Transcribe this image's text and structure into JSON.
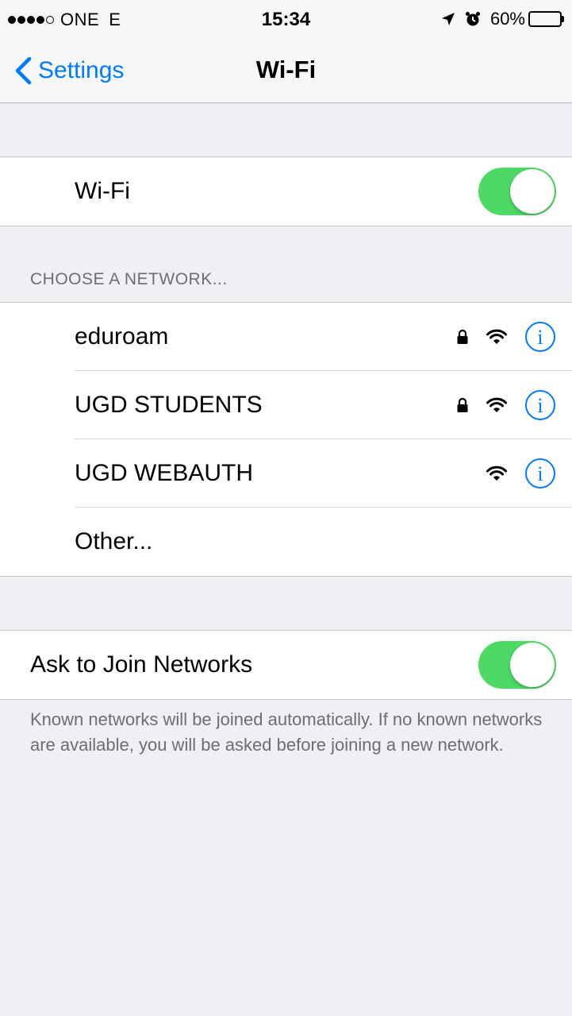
{
  "status": {
    "carrier": "ONE",
    "network_type": "E",
    "time": "15:34",
    "battery": "60%",
    "battery_level": 0.6,
    "icons": [
      "location-arrow-icon",
      "alarm-clock-icon"
    ]
  },
  "nav": {
    "back_label": "Settings",
    "title": "Wi-Fi"
  },
  "wifi": {
    "label": "Wi-Fi",
    "enabled": true
  },
  "networks": {
    "header": "CHOOSE A NETWORK...",
    "items": [
      {
        "name": "eduroam",
        "secured": true
      },
      {
        "name": "UGD STUDENTS",
        "secured": true
      },
      {
        "name": "UGD WEBAUTH",
        "secured": false
      }
    ],
    "other_label": "Other..."
  },
  "ask_to_join": {
    "label": "Ask to Join Networks",
    "enabled": true,
    "footer": "Known networks will be joined automatically. If no known networks are available, you will be asked before joining a new network."
  },
  "colors": {
    "accent": "#007aff",
    "toggle_on": "#4cd964",
    "background": "#efeff4"
  }
}
